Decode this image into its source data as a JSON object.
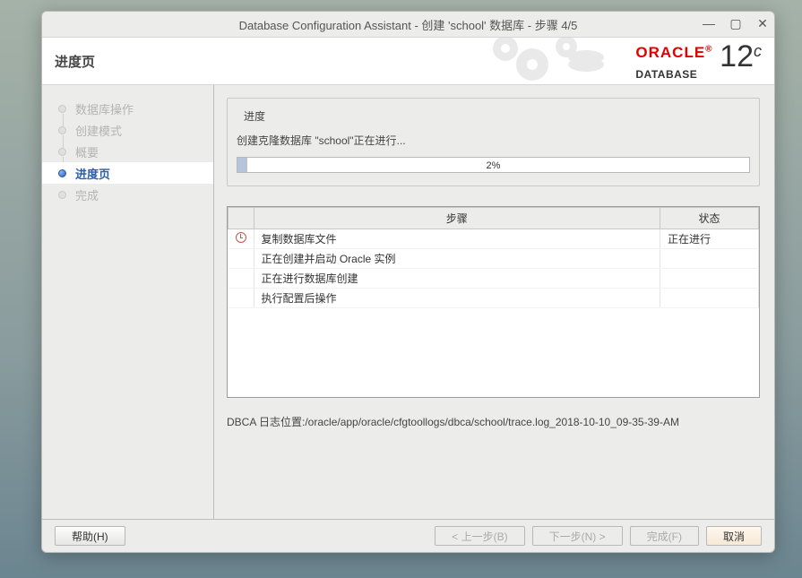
{
  "window": {
    "title": "Database Configuration Assistant - 创建  'school' 数据库  -  步骤 4/5"
  },
  "header": {
    "page_title": "进度页",
    "logo_brand": "ORACLE",
    "logo_sub": "DATABASE",
    "logo_version": "12",
    "logo_version_sup": "c"
  },
  "sidebar": {
    "items": [
      {
        "label": "数据库操作"
      },
      {
        "label": "创建模式"
      },
      {
        "label": "概要"
      },
      {
        "label": "进度页"
      },
      {
        "label": "完成"
      }
    ],
    "active_index": 3
  },
  "progress_section": {
    "legend": "进度",
    "status_text": "创建克隆数据库 \"school\"正在进行...",
    "percent": 2,
    "percent_label": "2%"
  },
  "steps_table": {
    "headers": {
      "icon": "",
      "step": "步骤",
      "status": "状态"
    },
    "rows": [
      {
        "icon": "clock",
        "step": "复制数据库文件",
        "status": "正在进行"
      },
      {
        "icon": "",
        "step": "正在创建并启动 Oracle 实例",
        "status": ""
      },
      {
        "icon": "",
        "step": "正在进行数据库创建",
        "status": ""
      },
      {
        "icon": "",
        "step": "执行配置后操作",
        "status": ""
      }
    ]
  },
  "log": {
    "text": "DBCA 日志位置:/oracle/app/oracle/cfgtoollogs/dbca/school/trace.log_2018-10-10_09-35-39-AM"
  },
  "footer": {
    "help": "帮助(H)",
    "back": "< 上一步(B)",
    "next": "下一步(N) >",
    "finish": "完成(F)",
    "cancel": "取消"
  }
}
